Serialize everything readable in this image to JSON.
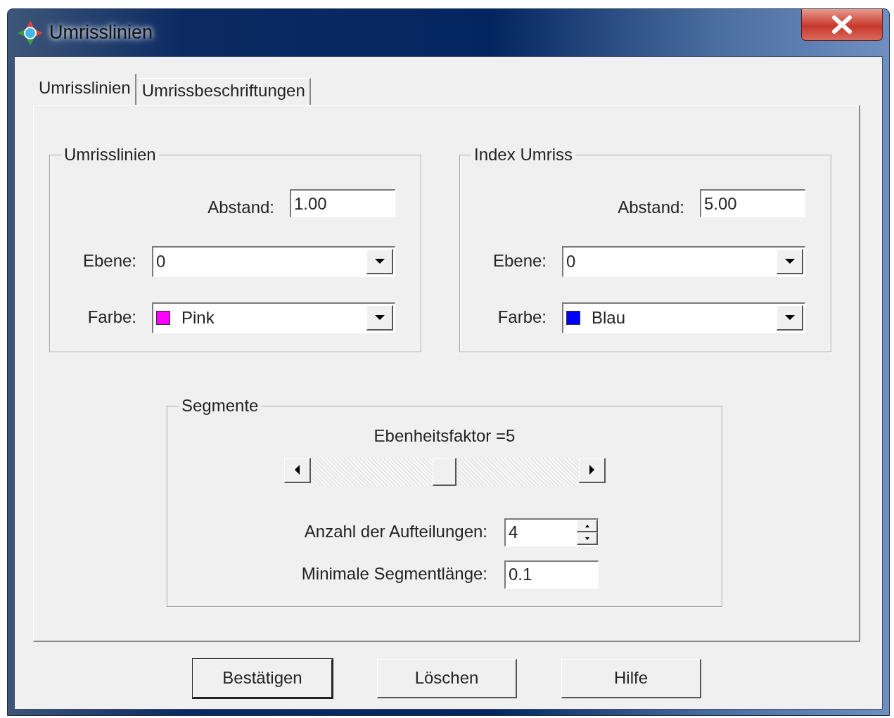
{
  "window": {
    "title": "Umrisslinien"
  },
  "tabs": [
    {
      "label": "Umrisslinien",
      "selected": true
    },
    {
      "label": "Umrissbeschriftungen",
      "selected": false
    }
  ],
  "groups": [
    {
      "title": "Umrisslinien",
      "spacing_label": "Abstand:",
      "spacing": "1.00",
      "layer_label": "Ebene:",
      "layer": "0",
      "color_label": "Farbe:",
      "color_name": "Pink",
      "color": "#ff00ff"
    },
    {
      "title": "Index Umriss",
      "spacing_label": "Abstand:",
      "spacing": "5.00",
      "layer_label": "Ebene:",
      "layer": "0",
      "color_label": "Farbe:",
      "color_name": "Blau",
      "color": "#0000ff"
    }
  ],
  "segments": {
    "title": "Segmente",
    "factor_label": "Ebenheitsfaktor =5",
    "slider": {
      "level": 0.5
    },
    "divisions_label": "Anzahl der Aufteilungen:",
    "divisions": "4",
    "min_length_label": "Minimale Segmentlänge:",
    "min_length": "0.1"
  },
  "buttons": [
    {
      "label": "Bestätigen",
      "default": true
    },
    {
      "label": "Löschen",
      "default": false
    },
    {
      "label": "Hilfe",
      "default": false
    }
  ]
}
